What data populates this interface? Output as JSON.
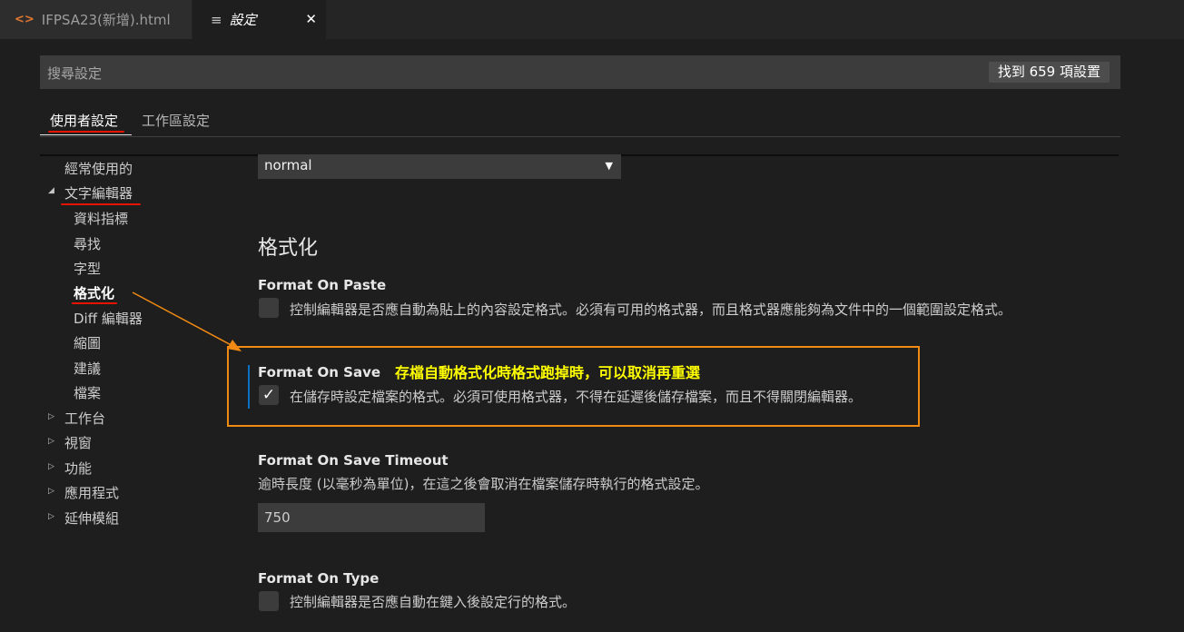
{
  "tabs": [
    {
      "icon": "code-file-icon",
      "label": "IFPSA23(新增).html"
    },
    {
      "icon": "settings-file-icon",
      "label": "設定",
      "close": "✕"
    }
  ],
  "search": {
    "placeholder": "搜尋設定",
    "value": "",
    "result_count": "找到 659 項設置"
  },
  "scopes": {
    "user": "使用者設定",
    "workspace": "工作區設定"
  },
  "toc": {
    "frequent": "經常使用的",
    "text_editor": "文字編輯器",
    "text_editor_children": [
      "資料指標",
      "尋找",
      "字型",
      "格式化",
      "Diff 編輯器",
      "縮圖",
      "建議",
      "檔案"
    ],
    "others": [
      "工作台",
      "視窗",
      "功能",
      "應用程式",
      "延伸模組"
    ]
  },
  "content": {
    "select_value": "normal",
    "section_title": "格式化",
    "settings": [
      {
        "title": "Format On Paste",
        "description": "控制編輯器是否應自動為貼上的內容設定格式。必須有可用的格式器，而且格式器應能夠為文件中的一個範圍設定格式。",
        "checked": false
      },
      {
        "title": "Format On Save",
        "description": "在儲存時設定檔案的格式。必須可使用格式器，不得在延遲後儲存檔案，而且不得關閉編輯器。",
        "checked": true
      },
      {
        "title": "Format On Save Timeout",
        "description": "逾時長度 (以毫秒為單位)，在這之後會取消在檔案儲存時執行的格式設定。",
        "value": "750"
      },
      {
        "title": "Format On Type",
        "description": "控制編輯器是否應自動在鍵入後設定行的格式。",
        "checked": false
      }
    ]
  },
  "annotation": {
    "text": "存檔自動格式化時格式跑掉時，可以取消再重選",
    "color": "#ffff00",
    "box_color": "#f08a12"
  },
  "colors": {
    "accent_underline": "#e51400",
    "focus_bar": "#0e70c0",
    "background": "#1e1e1e"
  }
}
